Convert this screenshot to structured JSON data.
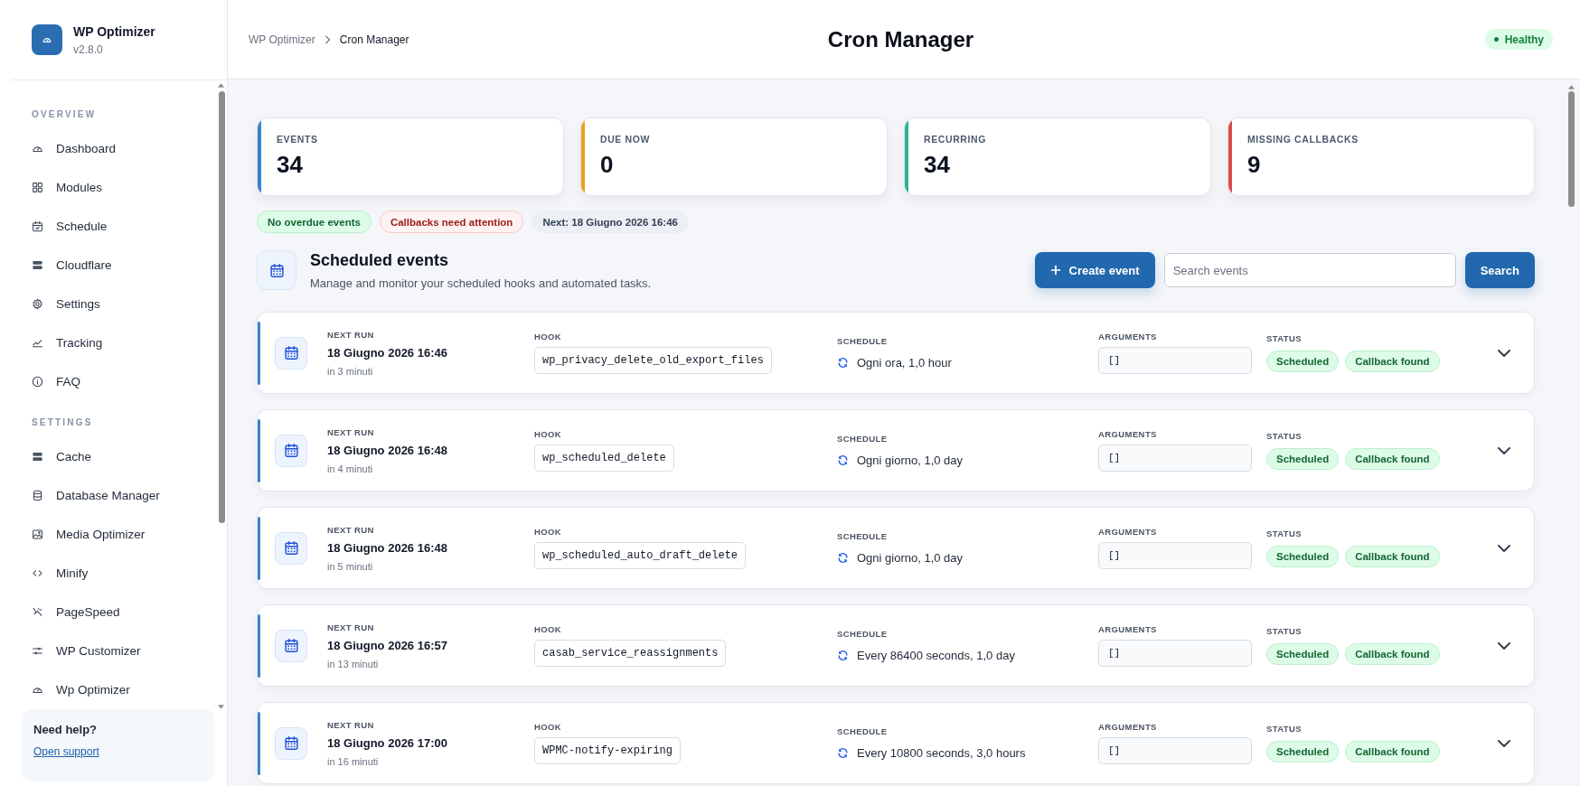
{
  "sidebar": {
    "brand": {
      "name": "WP Optimizer",
      "version": "v2.8.0"
    },
    "sections": [
      {
        "title": "OVERVIEW",
        "items": [
          {
            "label": "Dashboard",
            "selected": false
          },
          {
            "label": "Modules",
            "selected": false
          },
          {
            "label": "Schedule",
            "selected": false
          },
          {
            "label": "Cloudflare",
            "selected": false
          },
          {
            "label": "Settings",
            "selected": false
          },
          {
            "label": "Tracking",
            "selected": false
          },
          {
            "label": "FAQ",
            "selected": false
          }
        ]
      },
      {
        "title": "SETTINGS",
        "items": [
          {
            "label": "Cache",
            "selected": false
          },
          {
            "label": "Database Manager",
            "selected": false
          },
          {
            "label": "Media Optimizer",
            "selected": false
          },
          {
            "label": "Minify",
            "selected": false
          },
          {
            "label": "PageSpeed",
            "selected": false
          },
          {
            "label": "WP Customizer",
            "selected": false
          },
          {
            "label": "Wp Optimizer",
            "selected": false
          }
        ]
      }
    ],
    "help": {
      "title": "Need help?",
      "link": "Open support"
    }
  },
  "header": {
    "breadcrumb": [
      "WP Optimizer",
      "Cron Manager"
    ],
    "title": "Cron Manager",
    "status": {
      "label": "Healthy",
      "kind": "success"
    }
  },
  "stats": [
    {
      "label": "EVENTS",
      "value": "34",
      "color": "#3a84c9"
    },
    {
      "label": "DUE NOW",
      "value": "0",
      "color": "#f0a01a"
    },
    {
      "label": "RECURRING",
      "value": "34",
      "color": "#2bb39a"
    },
    {
      "label": "MISSING CALLBACKS",
      "value": "9",
      "color": "#dc4a4a"
    }
  ],
  "notices": [
    {
      "label": "No overdue events",
      "kind": "success"
    },
    {
      "label": "Callbacks need attention",
      "kind": "danger"
    },
    {
      "label": "Next: 18 Giugno 2026 16:46",
      "kind": "neutral"
    }
  ],
  "events_panel": {
    "title": "Scheduled events",
    "subtitle": "Manage and monitor your scheduled hooks and automated tasks.",
    "create_button": "Create event",
    "search": {
      "placeholder": "Search events"
    },
    "search_button": "Search"
  },
  "events": [
    {
      "next_run": {
        "label": "NEXT RUN",
        "value": "18 Giugno 2026 16:46",
        "note": "in 3 minuti"
      },
      "hook": {
        "label": "HOOK",
        "value": "wp_privacy_delete_old_export_files"
      },
      "schedule": {
        "label": "SCHEDULE",
        "value": "Ogni ora, 1,0 hour"
      },
      "arguments": {
        "label": "ARGUMENTS",
        "value": "[]"
      },
      "status": {
        "label": "STATUS",
        "badges": [
          {
            "label": "Scheduled",
            "kind": "success"
          },
          {
            "label": "Callback found",
            "kind": "success"
          }
        ]
      },
      "expanded": false
    },
    {
      "next_run": {
        "label": "NEXT RUN",
        "value": "18 Giugno 2026 16:48",
        "note": "in 4 minuti"
      },
      "hook": {
        "label": "HOOK",
        "value": "wp_scheduled_delete"
      },
      "schedule": {
        "label": "SCHEDULE",
        "value": "Ogni giorno, 1,0 day"
      },
      "arguments": {
        "label": "ARGUMENTS",
        "value": "[]"
      },
      "status": {
        "label": "STATUS",
        "badges": [
          {
            "label": "Scheduled",
            "kind": "success"
          },
          {
            "label": "Callback found",
            "kind": "success"
          }
        ]
      },
      "expanded": false
    },
    {
      "next_run": {
        "label": "NEXT RUN",
        "value": "18 Giugno 2026 16:48",
        "note": "in 5 minuti"
      },
      "hook": {
        "label": "HOOK",
        "value": "wp_scheduled_auto_draft_delete"
      },
      "schedule": {
        "label": "SCHEDULE",
        "value": "Ogni giorno, 1,0 day"
      },
      "arguments": {
        "label": "ARGUMENTS",
        "value": "[]"
      },
      "status": {
        "label": "STATUS",
        "badges": [
          {
            "label": "Scheduled",
            "kind": "success"
          },
          {
            "label": "Callback found",
            "kind": "success"
          }
        ]
      },
      "expanded": false
    },
    {
      "next_run": {
        "label": "NEXT RUN",
        "value": "18 Giugno 2026 16:57",
        "note": "in 13 minuti"
      },
      "hook": {
        "label": "HOOK",
        "value": "casab_service_reassignments"
      },
      "schedule": {
        "label": "SCHEDULE",
        "value": "Every 86400 seconds, 1,0 day"
      },
      "arguments": {
        "label": "ARGUMENTS",
        "value": "[]"
      },
      "status": {
        "label": "STATUS",
        "badges": [
          {
            "label": "Scheduled",
            "kind": "success"
          },
          {
            "label": "Callback found",
            "kind": "success"
          }
        ]
      },
      "expanded": false
    },
    {
      "next_run": {
        "label": "NEXT RUN",
        "value": "18 Giugno 2026 17:00",
        "note": "in 16 minuti"
      },
      "hook": {
        "label": "HOOK",
        "value": "WPMC-notify-expiring"
      },
      "schedule": {
        "label": "SCHEDULE",
        "value": "Every 10800 seconds, 3,0 hours"
      },
      "arguments": {
        "label": "ARGUMENTS",
        "value": "[]"
      },
      "status": {
        "label": "STATUS",
        "badges": [
          {
            "label": "Scheduled",
            "kind": "success"
          },
          {
            "label": "Callback found",
            "kind": "success"
          }
        ]
      },
      "expanded": false
    }
  ]
}
